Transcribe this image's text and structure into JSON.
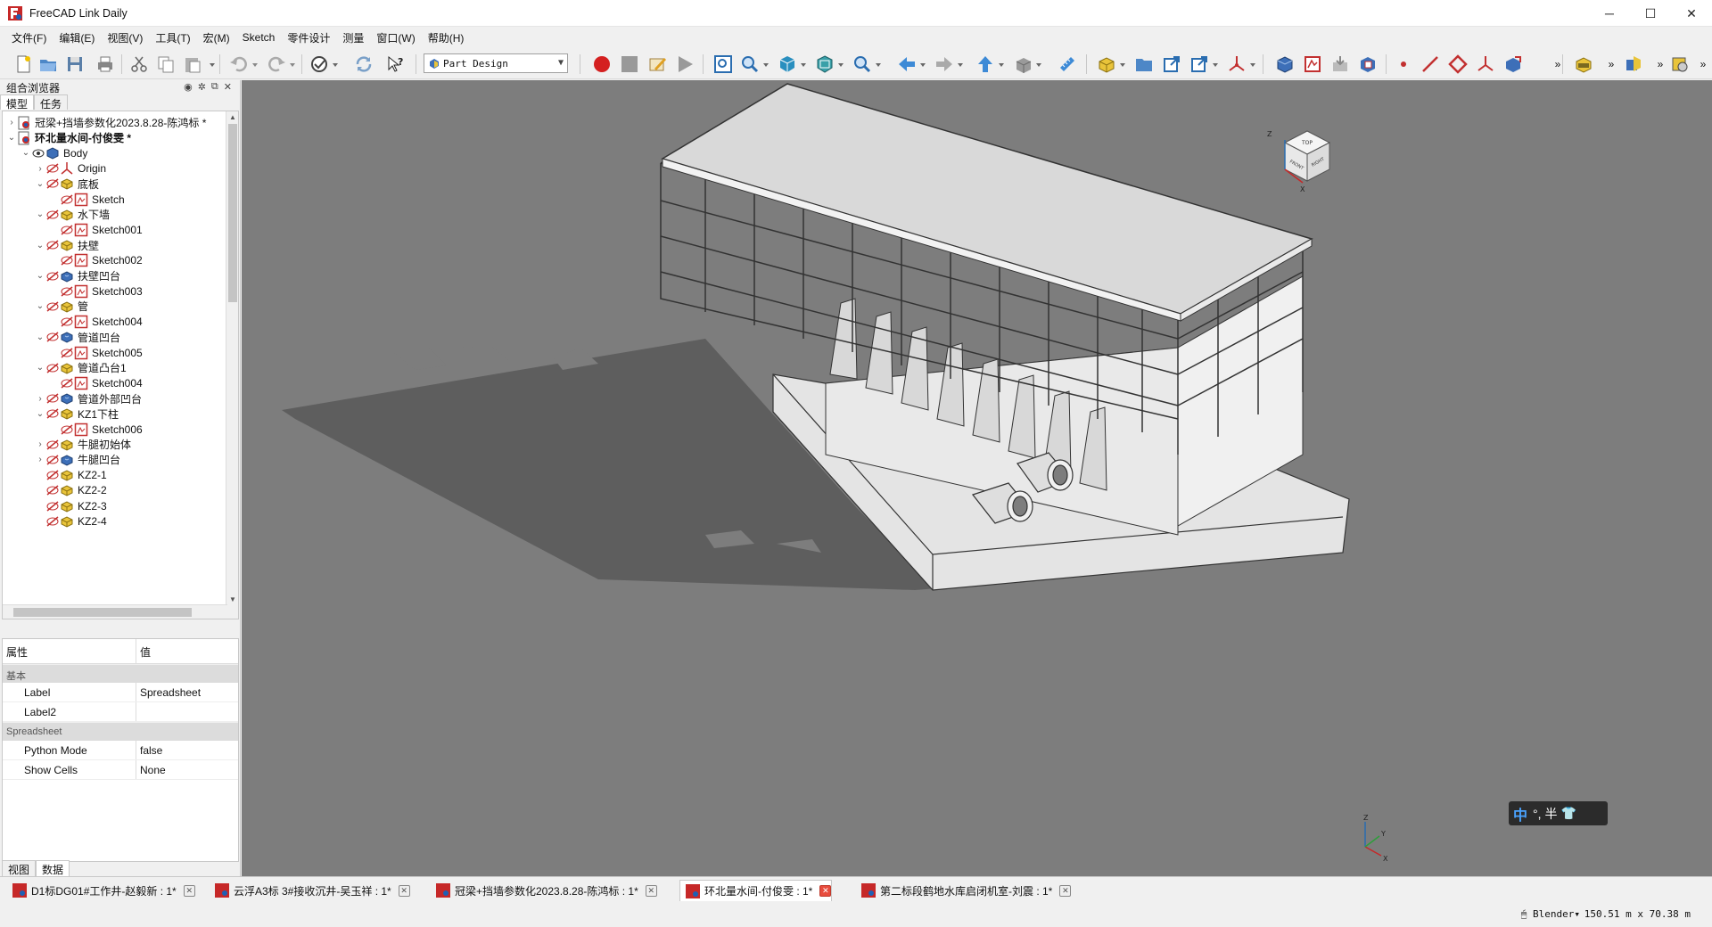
{
  "window": {
    "title": "FreeCAD Link Daily",
    "minimize": "─",
    "maximize": "☐",
    "close": "✕"
  },
  "menubar": [
    "文件(F)",
    "编辑(E)",
    "视图(V)",
    "工具(T)",
    "宏(M)",
    "Sketch",
    "零件设计",
    "测量",
    "窗口(W)",
    "帮助(H)"
  ],
  "toolbar": {
    "workbench": "Part Design",
    "overflow": "»"
  },
  "combo": {
    "title": "组合浏览器",
    "tabs": [
      "模型",
      "任务"
    ],
    "active_tab": "模型"
  },
  "tree": [
    {
      "label": "冠梁+挡墙参数化2023.8.28-陈鸿标 *",
      "icon": "document-icon",
      "depth": 0,
      "expand": "›",
      "bold": false
    },
    {
      "label": "环北量水间-付俊雯 *",
      "icon": "document-icon",
      "depth": 0,
      "expand": "⌄",
      "bold": true
    },
    {
      "label": "Body",
      "icon": "body-icon",
      "depth": 1,
      "expand": "⌄",
      "bold": false
    },
    {
      "label": "Origin",
      "icon": "origin-icon",
      "depth": 2,
      "expand": "›",
      "bold": false
    },
    {
      "label": "底板",
      "icon": "pad-icon",
      "depth": 2,
      "expand": "⌄",
      "bold": false
    },
    {
      "label": "Sketch",
      "icon": "sketch-icon",
      "depth": 3,
      "expand": "",
      "bold": false
    },
    {
      "label": "水下墙",
      "icon": "pad-icon",
      "depth": 2,
      "expand": "⌄",
      "bold": false
    },
    {
      "label": "Sketch001",
      "icon": "sketch-icon",
      "depth": 3,
      "expand": "",
      "bold": false
    },
    {
      "label": "扶壁",
      "icon": "pad-icon",
      "depth": 2,
      "expand": "⌄",
      "bold": false
    },
    {
      "label": "Sketch002",
      "icon": "sketch-icon",
      "depth": 3,
      "expand": "",
      "bold": false
    },
    {
      "label": "扶壁凹台",
      "icon": "pocket-icon",
      "depth": 2,
      "expand": "⌄",
      "bold": false
    },
    {
      "label": "Sketch003",
      "icon": "sketch-icon",
      "depth": 3,
      "expand": "",
      "bold": false
    },
    {
      "label": "管",
      "icon": "pad-icon",
      "depth": 2,
      "expand": "⌄",
      "bold": false
    },
    {
      "label": "Sketch004",
      "icon": "sketch-icon",
      "depth": 3,
      "expand": "",
      "bold": false
    },
    {
      "label": "管道凹台",
      "icon": "pocket-icon",
      "depth": 2,
      "expand": "⌄",
      "bold": false
    },
    {
      "label": "Sketch005",
      "icon": "sketch-icon",
      "depth": 3,
      "expand": "",
      "bold": false
    },
    {
      "label": "管道凸台1",
      "icon": "pad-icon",
      "depth": 2,
      "expand": "⌄",
      "bold": false
    },
    {
      "label": "Sketch004",
      "icon": "sketch-icon",
      "depth": 3,
      "expand": "",
      "bold": false
    },
    {
      "label": "管道外部凹台",
      "icon": "pocket-icon",
      "depth": 2,
      "expand": "›",
      "bold": false
    },
    {
      "label": "KZ1下柱",
      "icon": "pad-icon",
      "depth": 2,
      "expand": "⌄",
      "bold": false
    },
    {
      "label": "Sketch006",
      "icon": "sketch-icon",
      "depth": 3,
      "expand": "",
      "bold": false
    },
    {
      "label": "牛腿初始体",
      "icon": "pad-icon",
      "depth": 2,
      "expand": "›",
      "bold": false
    },
    {
      "label": "牛腿凹台",
      "icon": "pocket-icon",
      "depth": 2,
      "expand": "›",
      "bold": false
    },
    {
      "label": "KZ2-1",
      "icon": "pad-icon",
      "depth": 2,
      "expand": "",
      "bold": false
    },
    {
      "label": "KZ2-2",
      "icon": "pad-icon",
      "depth": 2,
      "expand": "",
      "bold": false
    },
    {
      "label": "KZ2-3",
      "icon": "pad-icon",
      "depth": 2,
      "expand": "",
      "bold": false
    },
    {
      "label": "KZ2-4",
      "icon": "pad-icon",
      "depth": 2,
      "expand": "",
      "bold": false
    }
  ],
  "properties": {
    "col_property": "属性",
    "col_value": "值",
    "groups": [
      {
        "name": "基本",
        "rows": [
          {
            "key": "Label",
            "value": "Spreadsheet"
          },
          {
            "key": "Label2",
            "value": ""
          }
        ]
      },
      {
        "name": "Spreadsheet",
        "rows": [
          {
            "key": "Python Mode",
            "value": "false"
          },
          {
            "key": "Show Cells",
            "value": "None"
          }
        ]
      }
    ]
  },
  "bottom_tabs": [
    "视图",
    "数据"
  ],
  "active_bottom_tab": "数据",
  "doc_tabs": [
    {
      "label": "D1标DG01#工作井-赵毅新 : 1*",
      "active": false
    },
    {
      "label": "云浮A3标 3#接收沉井-吴玉祥 : 1*",
      "active": false
    },
    {
      "label": "冠梁+挡墙参数化2023.8.28-陈鸿标 : 1*",
      "active": false
    },
    {
      "label": "环北量水间-付俊雯 : 1*",
      "active": true
    },
    {
      "label": "第二标段鹤地水库启闭机室-刘震 : 1*",
      "active": false
    }
  ],
  "status": {
    "navigation": "Blender",
    "dimensions": "150.51 m x 70.38 m"
  },
  "ime": {
    "lang": "中",
    "punct": "°,",
    "width": "半",
    "skin": "👕"
  },
  "navcube": {
    "top": "TOP",
    "front": "FRONT",
    "right": "RIGHT",
    "z": "Z",
    "x": "X",
    "y": "Y"
  },
  "colors": {
    "viewport": "#7d7d7d",
    "shadow": "#5e5e5e",
    "model_face": "#e9e9e9",
    "record": "#d42020"
  }
}
